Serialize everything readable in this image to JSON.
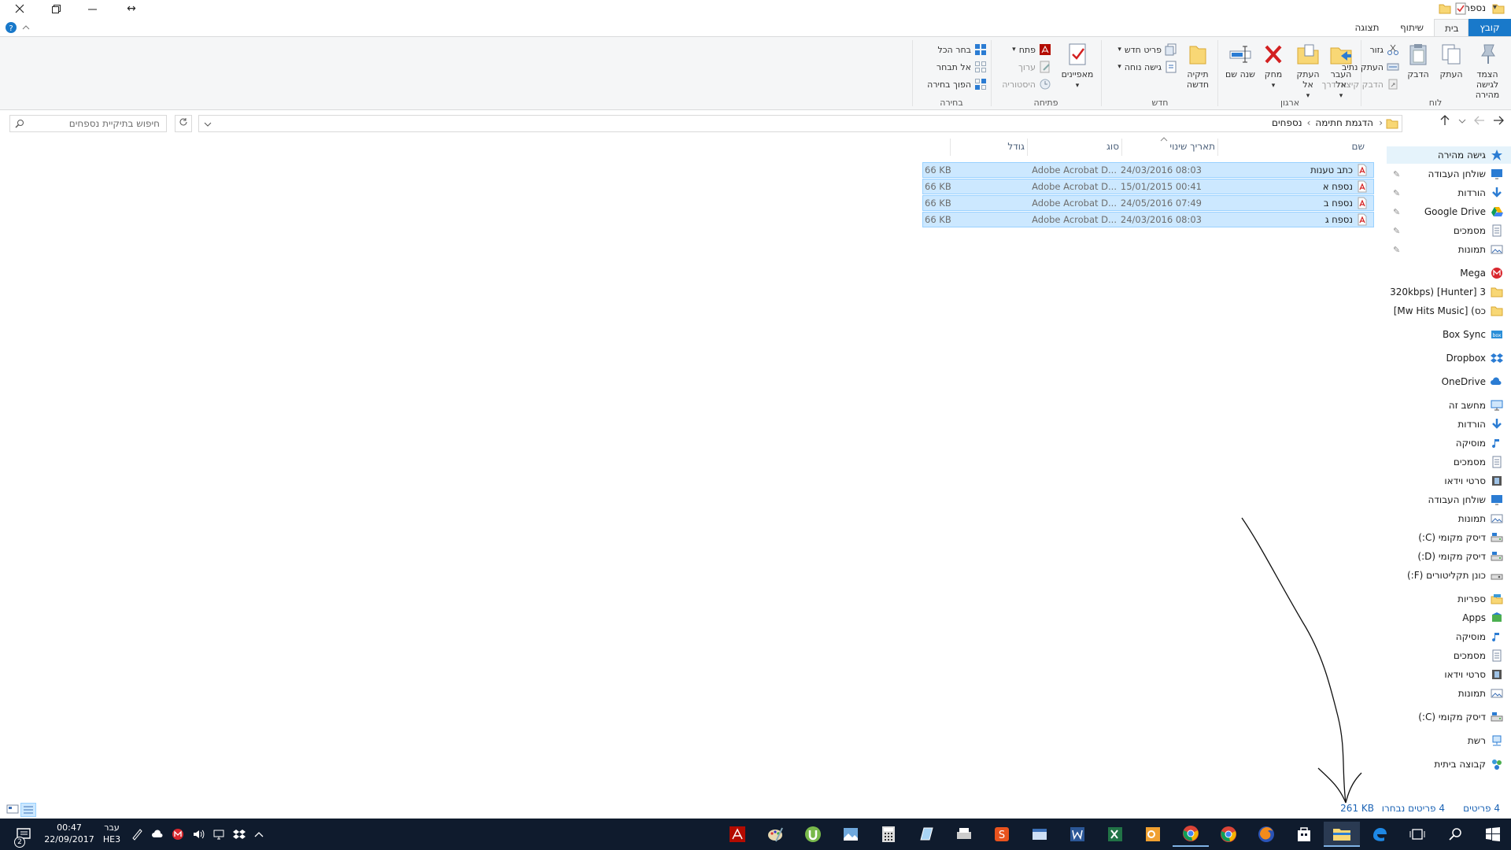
{
  "window": {
    "title": "נספחים",
    "controls": {
      "close": "✕",
      "restore": "⧉",
      "minimize": "—",
      "pin": "↔"
    },
    "quick_access_caret": "▾"
  },
  "ribbon_tabs": [
    "קובץ",
    "בית",
    "שיתוף",
    "תצוגה"
  ],
  "ribbon": {
    "groups": {
      "clipboard": {
        "label": "לוח",
        "pin_quick": "הצמד לגישה מהירה",
        "copy": "העתק",
        "paste": "הדבק",
        "cut": "גזור",
        "copy_path": "העתק נתיב",
        "paste_shortcut": "הדבק קיצור דרך"
      },
      "organize": {
        "label": "ארגון",
        "move_to": "העבר אל",
        "copy_to": "העתק אל",
        "delete": "מחק",
        "rename": "שנה שם"
      },
      "new": {
        "label": "חדש",
        "new_folder": "תיקיה חדשה",
        "new_item": "פריט חדש",
        "easy_access": "גישה נוחה"
      },
      "open": {
        "label": "פתיחה",
        "properties": "מאפיינים",
        "open": "פתח",
        "edit": "ערוך",
        "history": "היסטוריה"
      },
      "select": {
        "label": "בחירה",
        "select_all": "בחר הכל",
        "select_none": "אל תבחר",
        "invert": "הפוך בחירה"
      }
    }
  },
  "address": {
    "breadcrumb": [
      "הדגמת חתימה",
      "נספחים"
    ],
    "search_placeholder": "חיפוש בתיקיית נספחים"
  },
  "nav_pane": [
    {
      "label": "גישה מהירה",
      "icon": "star-icon",
      "pinned": false,
      "highlight": true
    },
    {
      "label": "שולחן העבודה",
      "icon": "desktop-icon",
      "pinned": true
    },
    {
      "label": "הורדות",
      "icon": "download-icon",
      "pinned": true
    },
    {
      "label": "Google Drive",
      "icon": "google-drive-icon",
      "pinned": true
    },
    {
      "label": "מסמכים",
      "icon": "documents-icon",
      "pinned": true
    },
    {
      "label": "תמונות",
      "icon": "pictures-icon",
      "pinned": true
    },
    {
      "label": "Mega",
      "icon": "mega-icon",
      "pinned": false,
      "gap": true
    },
    {
      "label": "3 320kbps) [Hunter]",
      "icon": "folder-icon",
      "pinned": false
    },
    {
      "label": "כס) [Mw Hits Music]",
      "icon": "folder-icon",
      "pinned": false
    },
    {
      "label": "Box Sync",
      "icon": "box-icon",
      "pinned": false,
      "gap": true
    },
    {
      "label": "Dropbox",
      "icon": "dropbox-icon",
      "pinned": false,
      "gap": true
    },
    {
      "label": "OneDrive",
      "icon": "onedrive-icon",
      "pinned": false,
      "gap": true
    },
    {
      "label": "מחשב זה",
      "icon": "computer-icon",
      "pinned": false,
      "gap": true
    },
    {
      "label": "הורדות",
      "icon": "download-icon",
      "pinned": false
    },
    {
      "label": "מוסיקה",
      "icon": "music-icon",
      "pinned": false
    },
    {
      "label": "מסמכים",
      "icon": "documents-icon",
      "pinned": false
    },
    {
      "label": "סרטי וידאו",
      "icon": "video-icon",
      "pinned": false
    },
    {
      "label": "שולחן העבודה",
      "icon": "desktop-icon",
      "pinned": false
    },
    {
      "label": "תמונות",
      "icon": "pictures-icon",
      "pinned": false
    },
    {
      "label": "דיסק מקומי (C:)",
      "icon": "drive-icon",
      "pinned": false
    },
    {
      "label": "דיסק מקומי (D:)",
      "icon": "drive-icon",
      "pinned": false
    },
    {
      "label": "כונן תקליטורים (F:)",
      "icon": "cd-drive-icon",
      "pinned": false
    },
    {
      "label": "ספריות",
      "icon": "library-icon",
      "pinned": false,
      "gap": true
    },
    {
      "label": "Apps",
      "icon": "apps-icon",
      "pinned": false
    },
    {
      "label": "מוסיקה",
      "icon": "music-icon",
      "pinned": false
    },
    {
      "label": "מסמכים",
      "icon": "documents-icon",
      "pinned": false
    },
    {
      "label": "סרטי וידאו",
      "icon": "video-icon",
      "pinned": false
    },
    {
      "label": "תמונות",
      "icon": "pictures-icon",
      "pinned": false
    },
    {
      "label": "דיסק מקומי (C:)",
      "icon": "drive-icon",
      "pinned": false,
      "gap": true
    },
    {
      "label": "רשת",
      "icon": "network-icon",
      "pinned": false,
      "gap": true
    },
    {
      "label": "קבוצה ביתית",
      "icon": "homegroup-icon",
      "pinned": false,
      "gap": true
    }
  ],
  "file_list": {
    "columns": {
      "name": "שם",
      "date": "תאריך שינוי",
      "type": "סוג",
      "size": "גודל"
    },
    "rows": [
      {
        "name": "כתב טענות",
        "date": "24/03/2016 08:03",
        "type": "Adobe Acrobat D...",
        "size": "66 KB"
      },
      {
        "name": "נספח א",
        "date": "15/01/2015 00:41",
        "type": "Adobe Acrobat D...",
        "size": "66 KB"
      },
      {
        "name": "נספח ב",
        "date": "24/05/2016 07:49",
        "type": "Adobe Acrobat D...",
        "size": "66 KB"
      },
      {
        "name": "נספח ג",
        "date": "24/03/2016 08:03",
        "type": "Adobe Acrobat D...",
        "size": "66 KB"
      }
    ]
  },
  "status": {
    "item_count": "4 פריטים",
    "selected": "4 פריטים נבחרו",
    "selected_size": "261 KB"
  },
  "taskbar": {
    "time": "00:47",
    "date": "22/09/2017",
    "lang": "עבר",
    "lang_code": "HE3",
    "notification_count": "2"
  },
  "colors": {
    "accent": "#1979ca",
    "selection": "#cce8ff",
    "taskbar": "#0f1b2d",
    "status_text": "#1b63b5"
  }
}
